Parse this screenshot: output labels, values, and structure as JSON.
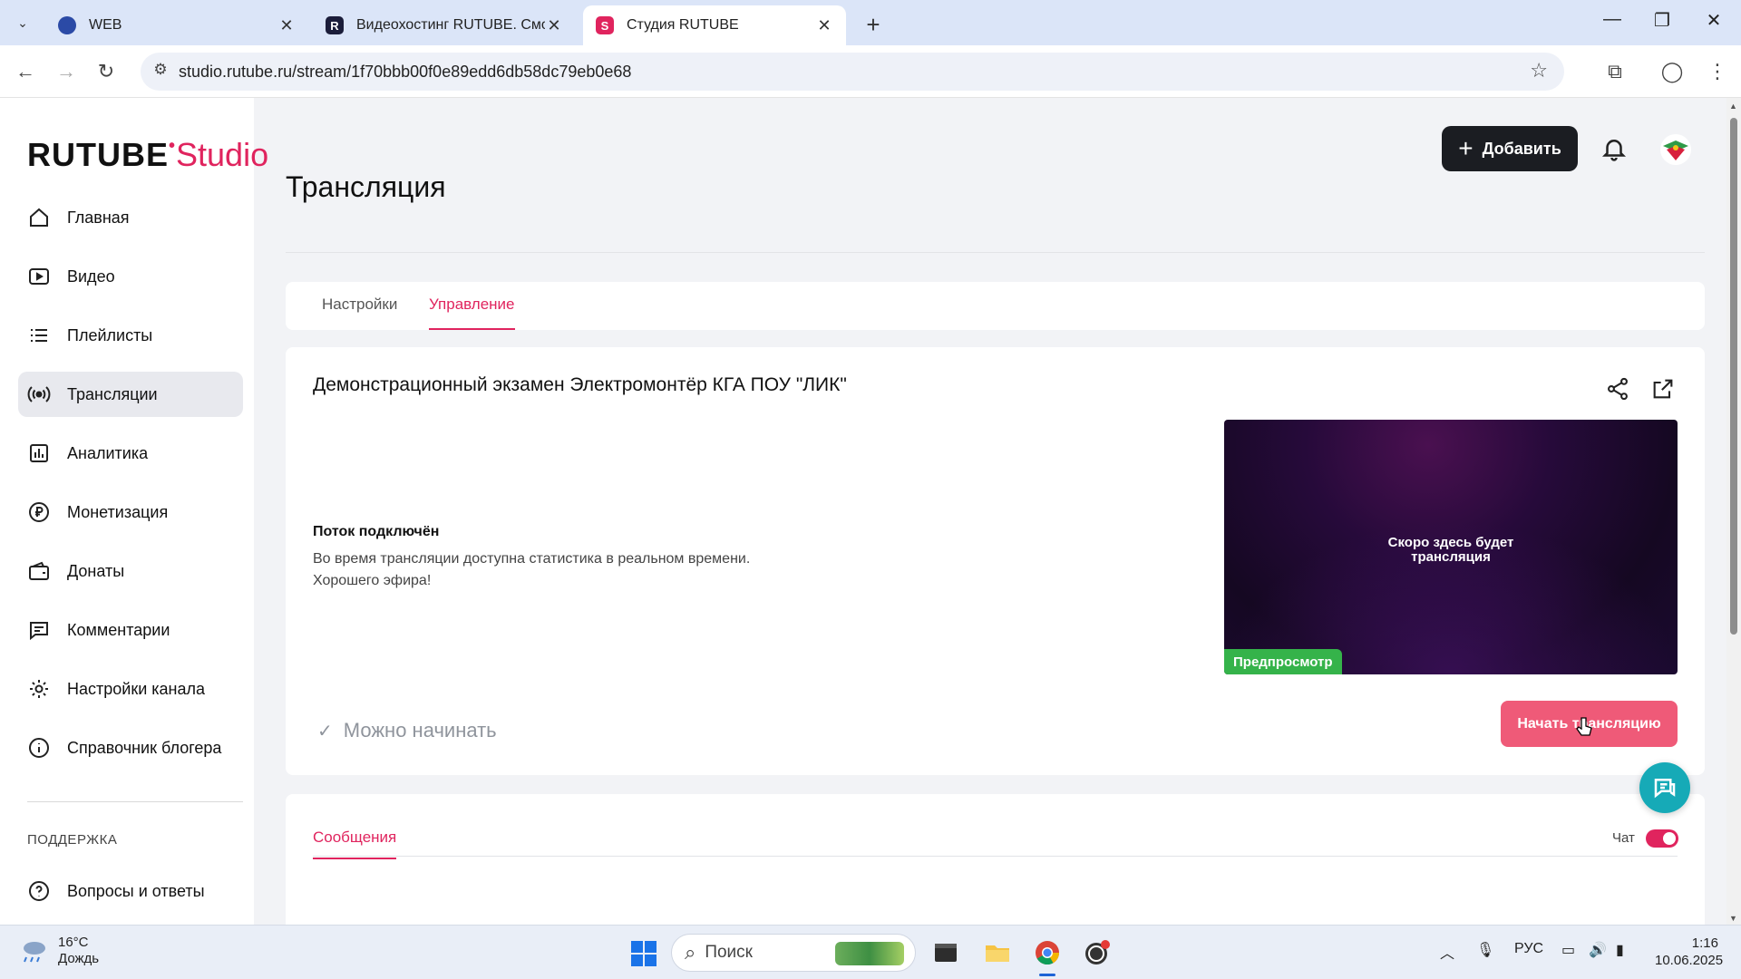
{
  "browser": {
    "tabs": [
      {
        "title": "WEB",
        "active": false
      },
      {
        "title": "Видеохостинг RUTUBE. Смотрите",
        "active": false
      },
      {
        "title": "Студия RUTUBE",
        "active": true
      }
    ],
    "url": "studio.rutube.ru/stream/1f70bbb00f0e89edd6db58dc79eb0e68"
  },
  "logo": {
    "brand": "RUTUBE",
    "product": "Studio"
  },
  "header": {
    "add_label": "Добавить"
  },
  "sidebar": {
    "items": [
      {
        "label": "Главная",
        "icon": "home-icon"
      },
      {
        "label": "Видео",
        "icon": "video-icon"
      },
      {
        "label": "Плейлисты",
        "icon": "playlist-icon"
      },
      {
        "label": "Трансляции",
        "icon": "broadcast-icon",
        "active": true
      },
      {
        "label": "Аналитика",
        "icon": "analytics-icon"
      },
      {
        "label": "Монетизация",
        "icon": "ruble-icon"
      },
      {
        "label": "Донаты",
        "icon": "wallet-icon"
      },
      {
        "label": "Комментарии",
        "icon": "comment-icon"
      },
      {
        "label": "Настройки канала",
        "icon": "gear-icon"
      },
      {
        "label": "Справочник блогера",
        "icon": "info-icon"
      }
    ],
    "support_heading": "ПОДДЕРЖКА",
    "support_items": [
      {
        "label": "Вопросы и ответы",
        "icon": "help-icon"
      }
    ]
  },
  "main": {
    "title": "Трансляция",
    "tabs": [
      {
        "label": "Настройки",
        "active": false
      },
      {
        "label": "Управление",
        "active": true
      }
    ],
    "stream": {
      "title": "Демонстрационный экзамен Электромонтёр КГА ПОУ \"ЛИК\"",
      "status_heading": "Поток подключён",
      "status_line1": "Во время трансляции доступна статистика в реальном времени.",
      "status_line2": "Хорошего эфира!",
      "preview_line1": "Скоро здесь будет",
      "preview_line2": "трансляция",
      "preview_badge": "Предпросмотр",
      "ready_label": "Можно начинать",
      "start_label": "Начать трансляцию"
    },
    "chat": {
      "tab_label": "Сообщения",
      "toggle_label": "Чат",
      "toggle_on": true
    }
  },
  "taskbar": {
    "temperature": "16°C",
    "weather": "Дождь",
    "search_placeholder": "Поиск",
    "language": "РУС",
    "time": "1:16",
    "date": "10.06.2025"
  },
  "colors": {
    "accent": "#e0245e",
    "start_button": "#ef5a78",
    "preview_badge": "#35b34a",
    "fab": "#16aab7"
  }
}
